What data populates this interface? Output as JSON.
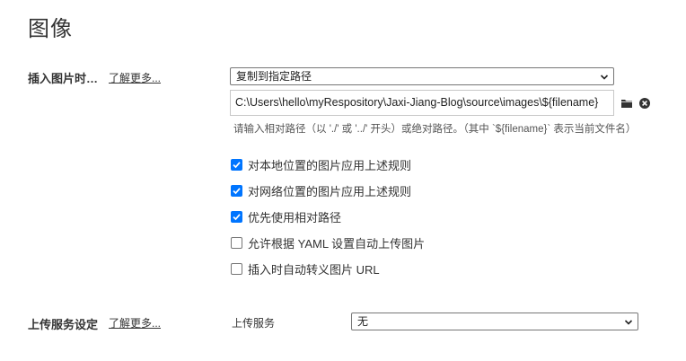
{
  "section": {
    "title": "图像"
  },
  "insert_image": {
    "label": "插入图片时…",
    "learn_more": "了解更多...",
    "action_selected": "复制到指定路径",
    "path_value": "C:\\Users\\hello\\myRespository\\Jaxi-Jiang-Blog\\source\\images\\${filename}",
    "hint": "请输入相对路径（以 './' 或 '../' 开头）或绝对路径。（其中 `${filename}` 表示当前文件名）",
    "browse_icon": "folder-icon",
    "clear_icon": "clear-circle-icon"
  },
  "options": [
    {
      "label": "对本地位置的图片应用上述规则",
      "checked": true
    },
    {
      "label": "对网络位置的图片应用上述规则",
      "checked": true
    },
    {
      "label": "优先使用相对路径",
      "checked": true
    },
    {
      "label": "允许根据 YAML 设置自动上传图片",
      "checked": false
    },
    {
      "label": "插入时自动转义图片 URL",
      "checked": false
    }
  ],
  "upload": {
    "label": "上传服务设定",
    "learn_more": "了解更多...",
    "service_label": "上传服务",
    "service_selected": "无"
  },
  "colors": {
    "checkbox_accent": "#0075ff",
    "text": "#333333"
  }
}
